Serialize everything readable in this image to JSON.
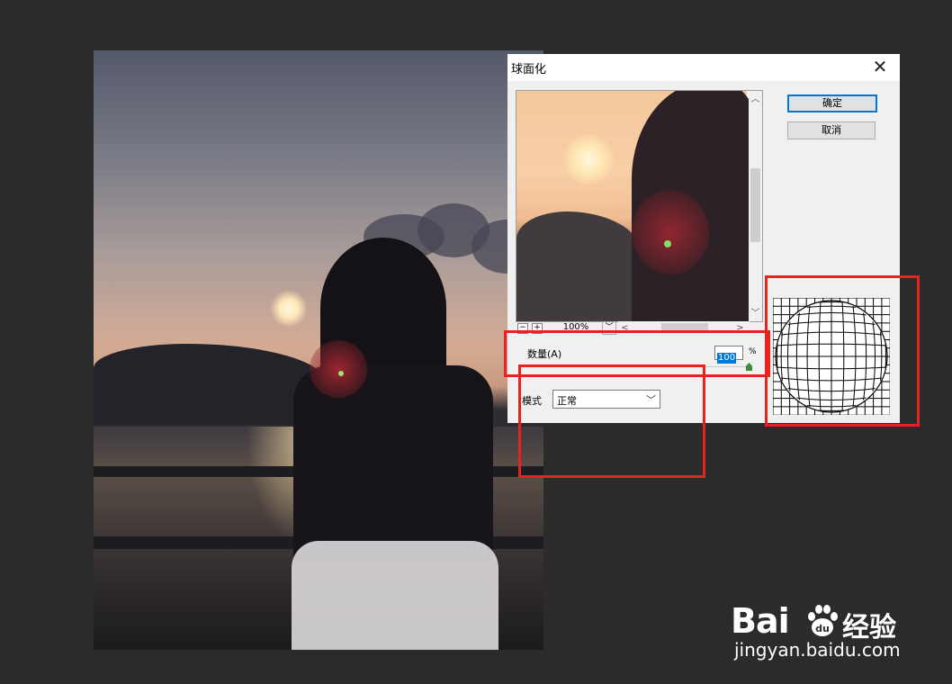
{
  "dialog": {
    "title": "球面化",
    "close_icon": "close-icon",
    "ok_label": "确定",
    "cancel_label": "取消",
    "zoom_value": "100%",
    "zoom_out_label": "−",
    "zoom_in_label": "+",
    "amount_label": "数量(A)",
    "amount_value": "100",
    "amount_unit": "%",
    "amount_slider_fraction": 1.0,
    "mode_label": "模式",
    "mode_value": "正常"
  },
  "watermark": {
    "logo_text_left": "Bai",
    "logo_text_right": "经验",
    "url": "jingyan.baidu.com",
    "logo_paw": "du"
  },
  "colors": {
    "highlight_red": "#e8231f",
    "accent_blue": "#0078d7",
    "dialog_bg": "#f0f0f0",
    "workspace_bg": "#2b2b2b"
  }
}
